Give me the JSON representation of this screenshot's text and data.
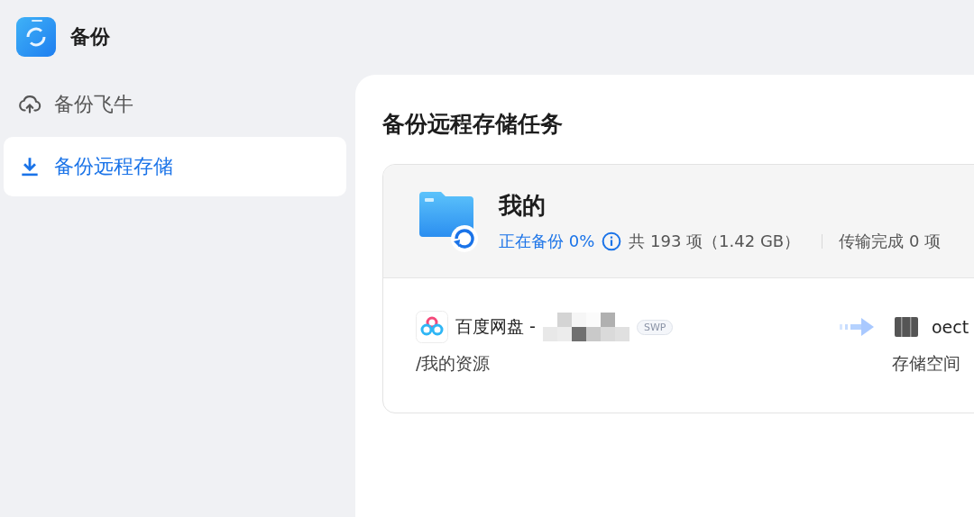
{
  "app": {
    "title": "备份"
  },
  "sidebar": {
    "items": [
      {
        "kind": "upload",
        "label": "备份飞牛",
        "selected": false
      },
      {
        "kind": "download",
        "label": "备份远程存储",
        "selected": true
      }
    ]
  },
  "page": {
    "title": "备份远程存储任务"
  },
  "tasks": [
    {
      "name": "我的",
      "status": "正在备份 0%",
      "summary": "共 193 项（1.42 GB）",
      "transferred": "传输完成 0 项",
      "source": {
        "name": "百度网盘 -",
        "badge": "SWP",
        "path": "/我的资源"
      },
      "target": {
        "name": "oect",
        "path": "存储空间"
      }
    }
  ]
}
